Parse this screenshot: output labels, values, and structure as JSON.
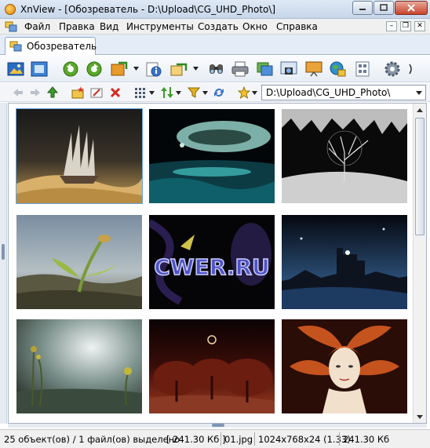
{
  "window": {
    "title": "XnView - [Обозреватель - D:\\Upload\\CG_UHD_Photo\\]",
    "icons": {
      "app": "xnview-app-icon",
      "minimize": "minimize-icon",
      "maximize": "maximize-icon",
      "close": "close-icon"
    }
  },
  "menu": {
    "items": [
      "Файл",
      "Правка",
      "Вид",
      "Инструменты",
      "Создать",
      "Окно",
      "Справка"
    ]
  },
  "tabs": [
    {
      "label": "Обозреватель",
      "icon": "browser-tab-icon"
    }
  ],
  "toolbar": {
    "buttons": [
      "view-image-icon",
      "fullscreen-icon",
      "rotate-left-icon",
      "rotate-right-icon",
      "image-convert-icon",
      "properties-icon",
      "copy-to-icon",
      "find-icon",
      "print-icon",
      "batch-convert-icon",
      "capture-icon",
      "slideshow-icon",
      "web-icon",
      "multipage-icon",
      "settings-icon"
    ]
  },
  "navigation": {
    "buttons": [
      "back-icon",
      "forward-icon",
      "up-folder-icon",
      "new-folder-icon",
      "rename-icon",
      "delete-icon",
      "view-mode-icon",
      "sort-icon",
      "filter-icon",
      "refresh-icon",
      "favorites-icon"
    ],
    "path": "D:\\Upload\\CG_UHD_Photo\\"
  },
  "thumbnails": [
    {
      "name": "ghost-ship-desert",
      "selected": true
    },
    {
      "name": "planet-ocean-glow",
      "selected": false
    },
    {
      "name": "dark-frozen-tree",
      "selected": false
    },
    {
      "name": "alien-sprout-landscape",
      "selected": false
    },
    {
      "name": "cwer-logo-art",
      "selected": false,
      "text": "CWER.RU"
    },
    {
      "name": "blue-cathedral-night",
      "selected": false
    },
    {
      "name": "storm-swamp-plants",
      "selected": false
    },
    {
      "name": "red-eye-forest",
      "selected": false
    },
    {
      "name": "orange-feather-woman",
      "selected": false
    }
  ],
  "status": {
    "selection": "25 объект(ов) / 1 файл(ов) выделено",
    "selected_size": "[ 241.30 Кб ]",
    "filename": "01.jpg",
    "dimensions": "1024x768x24 (1.33)",
    "file_size": "241.30 Кб"
  }
}
